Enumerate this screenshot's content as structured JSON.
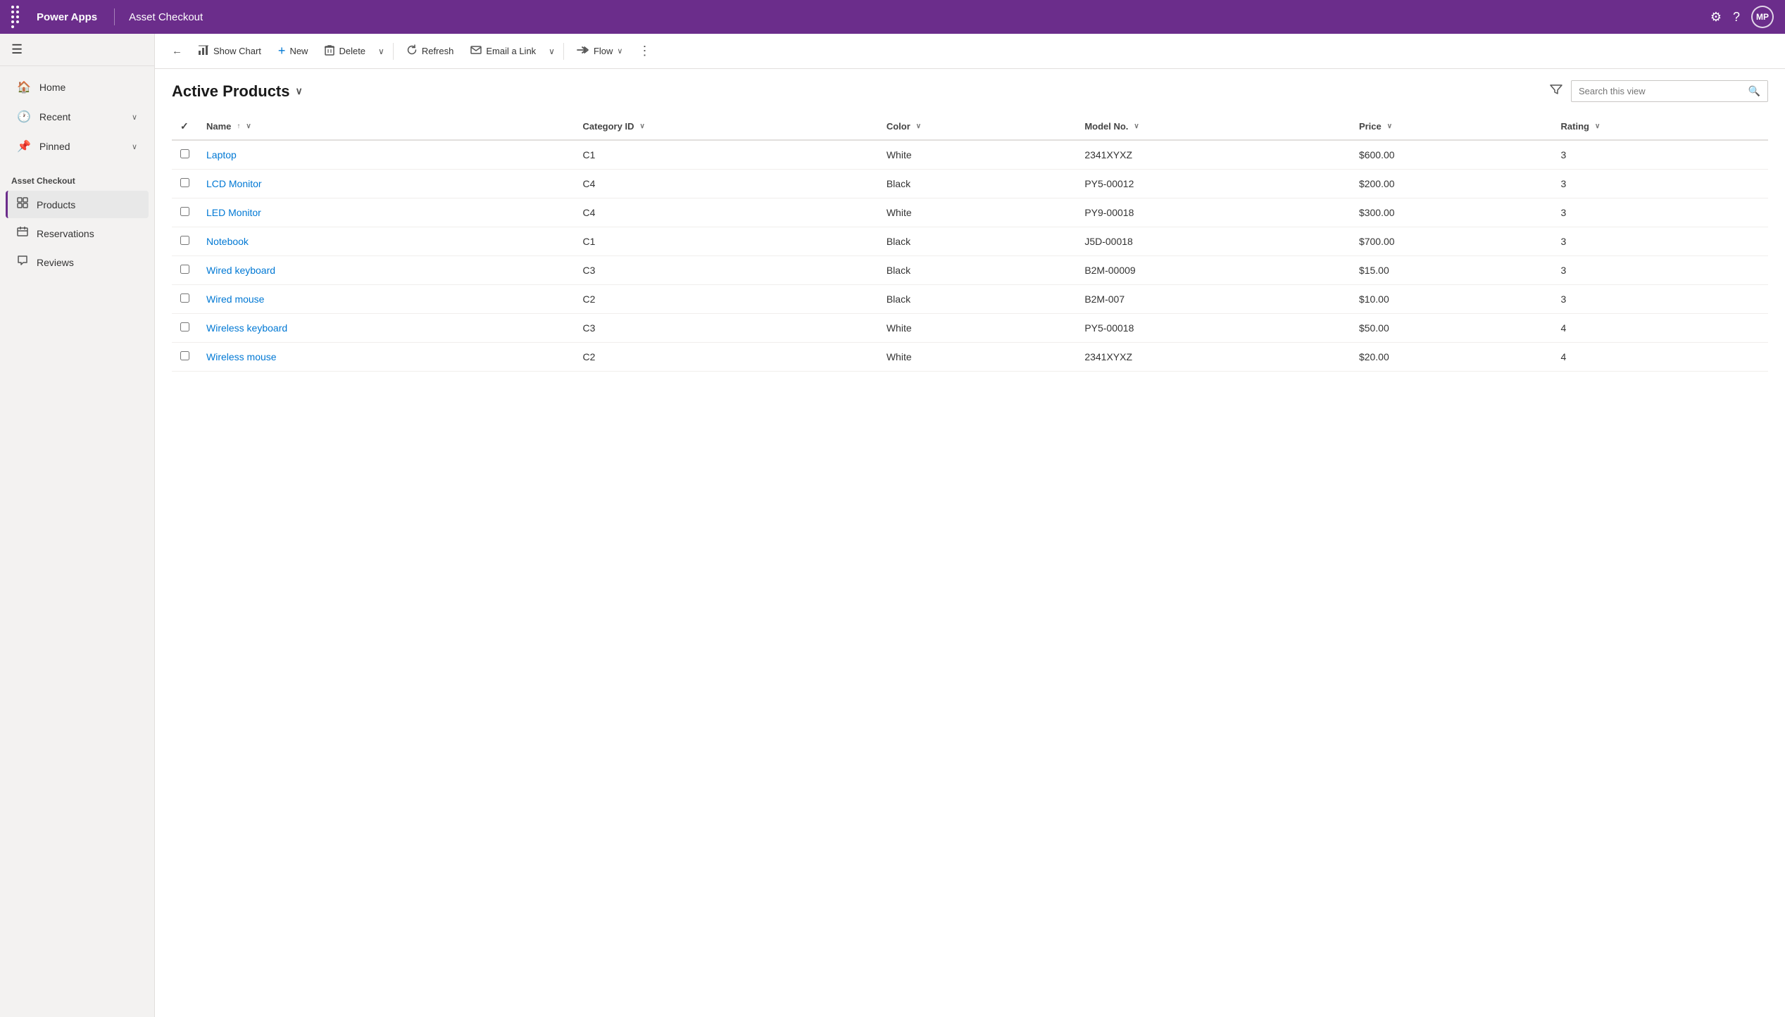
{
  "topbar": {
    "app_name": "Power Apps",
    "app_title": "Asset Checkout",
    "avatar_initials": "MP",
    "grid_icon": "⣿",
    "settings_label": "Settings",
    "help_label": "Help"
  },
  "sidebar": {
    "hamburger_label": "≡",
    "nav_items": [
      {
        "id": "home",
        "icon": "⌂",
        "label": "Home"
      },
      {
        "id": "recent",
        "icon": "○",
        "label": "Recent",
        "has_chevron": true
      },
      {
        "id": "pinned",
        "icon": "♦",
        "label": "Pinned",
        "has_chevron": true
      }
    ],
    "section_title": "Asset Checkout",
    "app_items": [
      {
        "id": "products",
        "icon": "☰",
        "label": "Products",
        "active": true
      },
      {
        "id": "reservations",
        "icon": "☰",
        "label": "Reservations",
        "active": false
      },
      {
        "id": "reviews",
        "icon": "☰",
        "label": "Reviews",
        "active": false
      }
    ]
  },
  "toolbar": {
    "back_icon": "←",
    "show_chart_label": "Show Chart",
    "show_chart_icon": "📊",
    "new_label": "New",
    "new_icon": "+",
    "delete_label": "Delete",
    "delete_icon": "🗑",
    "delete_dropdown": "∨",
    "refresh_label": "Refresh",
    "refresh_icon": "↻",
    "email_link_label": "Email a Link",
    "email_link_icon": "✉",
    "email_dropdown": "∨",
    "flow_label": "Flow",
    "flow_icon": "≫",
    "flow_dropdown": "∨",
    "more_icon": "⋮"
  },
  "view": {
    "title": "Active Products",
    "title_dropdown": "∨",
    "filter_icon": "⊟",
    "search_placeholder": "Search this view",
    "search_icon": "🔍",
    "columns": [
      {
        "id": "name",
        "label": "Name",
        "sortable": true,
        "sort_asc": true,
        "has_dropdown": true
      },
      {
        "id": "category",
        "label": "Category ID",
        "sortable": true,
        "has_dropdown": true
      },
      {
        "id": "color",
        "label": "Color",
        "sortable": true,
        "has_dropdown": true
      },
      {
        "id": "model",
        "label": "Model No.",
        "sortable": true,
        "has_dropdown": true
      },
      {
        "id": "price",
        "label": "Price",
        "sortable": true,
        "has_dropdown": true
      },
      {
        "id": "rating",
        "label": "Rating",
        "sortable": true,
        "has_dropdown": true
      }
    ],
    "rows": [
      {
        "name": "Laptop",
        "category": "C1",
        "color": "White",
        "model": "2341XYXZ",
        "price": "$600.00",
        "rating": "3"
      },
      {
        "name": "LCD Monitor",
        "category": "C4",
        "color": "Black",
        "model": "PY5-00012",
        "price": "$200.00",
        "rating": "3"
      },
      {
        "name": "LED Monitor",
        "category": "C4",
        "color": "White",
        "model": "PY9-00018",
        "price": "$300.00",
        "rating": "3"
      },
      {
        "name": "Notebook",
        "category": "C1",
        "color": "Black",
        "model": "J5D-00018",
        "price": "$700.00",
        "rating": "3"
      },
      {
        "name": "Wired keyboard",
        "category": "C3",
        "color": "Black",
        "model": "B2M-00009",
        "price": "$15.00",
        "rating": "3"
      },
      {
        "name": "Wired mouse",
        "category": "C2",
        "color": "Black",
        "model": "B2M-007",
        "price": "$10.00",
        "rating": "3"
      },
      {
        "name": "Wireless keyboard",
        "category": "C3",
        "color": "White",
        "model": "PY5-00018",
        "price": "$50.00",
        "rating": "4"
      },
      {
        "name": "Wireless mouse",
        "category": "C2",
        "color": "White",
        "model": "2341XYXZ",
        "price": "$20.00",
        "rating": "4"
      }
    ]
  },
  "colors": {
    "purple": "#6b2d8b",
    "link_blue": "#0078d4"
  }
}
